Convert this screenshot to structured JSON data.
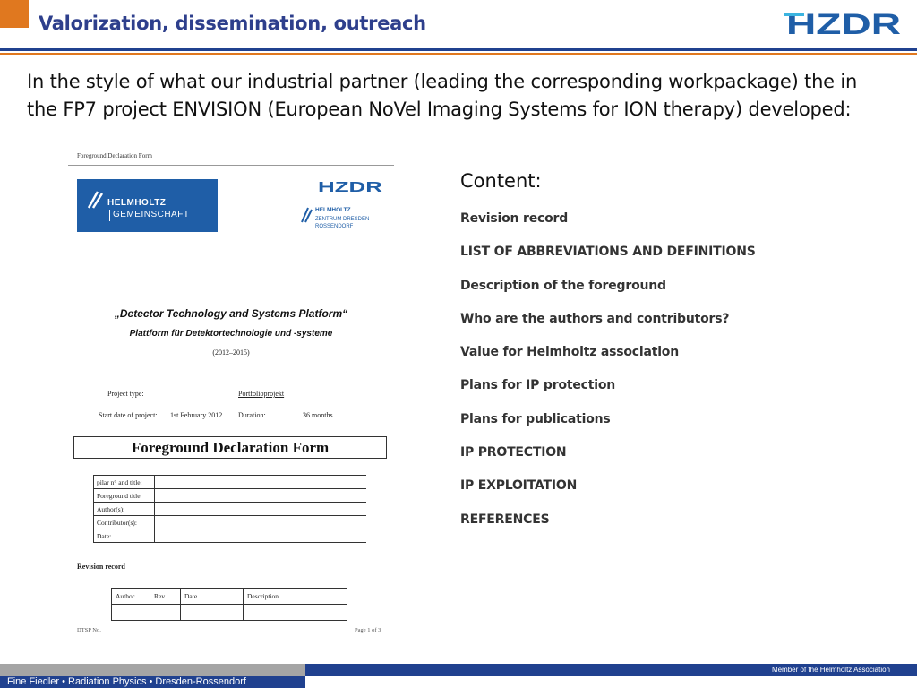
{
  "slide": {
    "title": "Valorization, dissemination, outreach",
    "intro": "In the style of what our industrial partner (leading the corresponding workpackage) the in the FP7 project ENVISION (European NoVel Imaging Systems for ION therapy) developed:",
    "logo_text": "HZDR"
  },
  "form": {
    "header": "Foreground Declaration Form",
    "helmholtz_logo": {
      "line1": "HELMHOLTZ",
      "line2": "GEMEINSCHAFT"
    },
    "hzdr_small": {
      "logo": "HZDR",
      "line1": "HELMHOLTZ",
      "line2": "ZENTRUM DRESDEN",
      "line3": "ROSSENDORF"
    },
    "project_title": "„Detector Technology  and Systems  Platform“",
    "project_subtitle": "Plattform für Detektortechnologie  und -systeme",
    "years": "(2012–2015)",
    "project_type_label": "Project type:",
    "project_type_value": "Portfolioprojekt",
    "start_label": "Start date of project:",
    "start_value": "1st February  2012",
    "duration_label": "Duration:",
    "duration_value": "36 months",
    "declaration_title": "Foreground Declaration Form",
    "info_rows": [
      "pilar n° and title:",
      "Foreground title",
      "Author(s):",
      "Contributor(s):",
      "Date:"
    ],
    "revision_label": "Revision record",
    "revision_cols": [
      "Author",
      "Rev.",
      "Date",
      "Description"
    ],
    "footer_left": "DTSP No.",
    "footer_right": "Page 1 of 3"
  },
  "content": {
    "heading": "Content:",
    "items": [
      "Revision record",
      "LIST OF ABBREVIATIONS AND DEFINITIONS",
      "Description of the foreground",
      "Who are the authors and contributors?",
      "Value for Helmholtz association",
      "Plans for IP protection",
      "Plans for publications",
      "IP PROTECTION",
      "IP EXPLOITATION",
      "REFERENCES"
    ]
  },
  "footer": {
    "author": "Fine Fiedler • Radiation Physics • Dresden-Rossendorf",
    "member": "Member of the Helmholtz Association"
  },
  "colors": {
    "brand_blue": "#20418f",
    "accent_orange": "#e0781f",
    "title_blue": "#2e3f8c",
    "helmholtz_blue": "#1f5ea7"
  }
}
